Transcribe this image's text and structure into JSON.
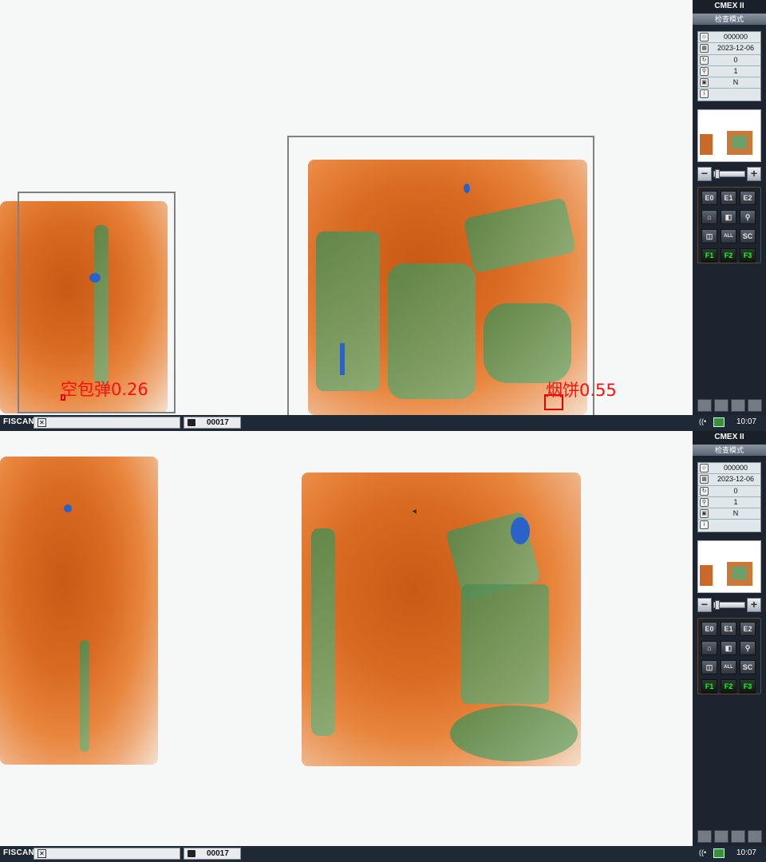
{
  "app": {
    "brand": "FISCAN",
    "title": "CMEX II",
    "mode": "检查模式"
  },
  "panel_info": [
    {
      "icon": "user-icon",
      "value": "000000"
    },
    {
      "icon": "calendar-icon",
      "value": "2023-12-06"
    },
    {
      "icon": "counter-icon",
      "value": "0"
    },
    {
      "icon": "magnifier-icon",
      "value": "1"
    },
    {
      "icon": "bag-icon",
      "value": "N"
    },
    {
      "icon": "info-icon",
      "value": ""
    }
  ],
  "buttons": [
    "E0",
    "E1",
    "E2",
    "home",
    "split",
    "zoom",
    "view",
    "ALL",
    "SC",
    "F1",
    "F2",
    "F3"
  ],
  "status": {
    "bag_count": "00017",
    "time": "10:07"
  },
  "top_view": {
    "detections": [
      {
        "label": "空包弹0.26",
        "color": "#ff1010"
      },
      {
        "label": "烟饼0.55",
        "color": "#ff1010"
      }
    ]
  },
  "bottom_view": {
    "detections": []
  }
}
